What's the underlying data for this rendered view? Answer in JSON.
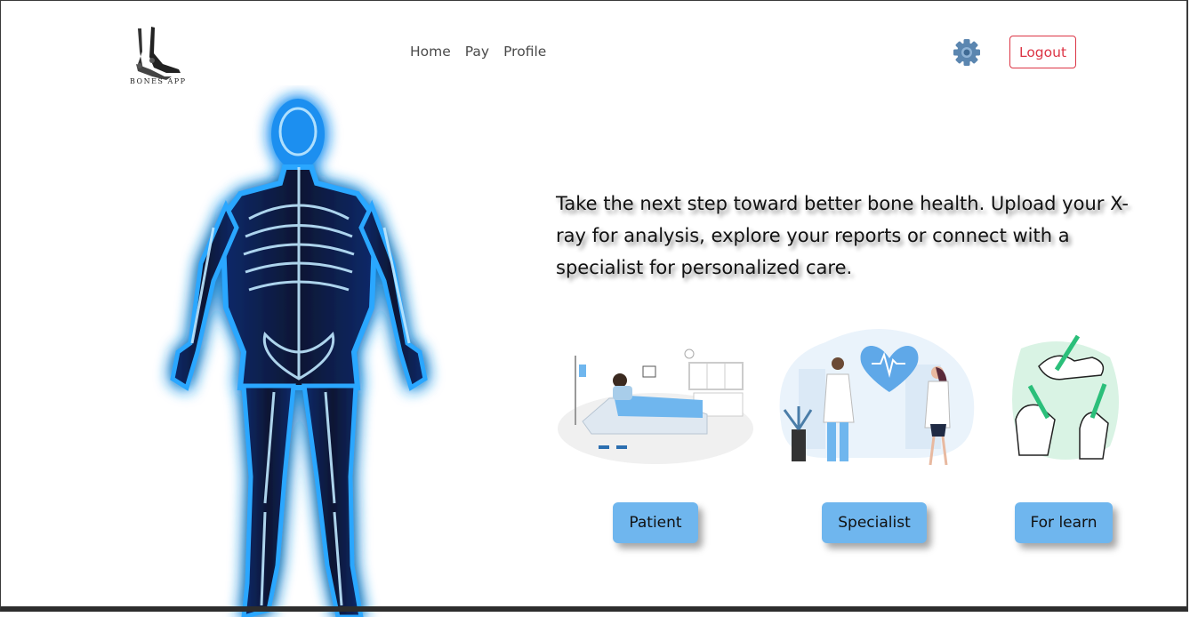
{
  "brand": {
    "logo_text": "BONES APP",
    "logo_icon": "foot-bones-icon"
  },
  "nav": {
    "home": "Home",
    "pay": "Pay",
    "profile": "Profile"
  },
  "header": {
    "settings_icon": "gear-icon",
    "logout_label": "Logout"
  },
  "main": {
    "intro": "Take the next step toward better bone health. Upload your X-ray for analysis, explore your reports or connect with a specialist for personalized care."
  },
  "cards": [
    {
      "label": "Patient",
      "illustration": "patient-hospital-bed-illustration"
    },
    {
      "label": "Specialist",
      "illustration": "doctors-heart-illustration"
    },
    {
      "label": "For learn",
      "illustration": "hands-writing-illustration"
    }
  ],
  "colors": {
    "accent_button": "#6fb6ee",
    "logout": "#dc3545",
    "gear": "#5b86b0",
    "xray_glow": "#1aa8ff"
  }
}
